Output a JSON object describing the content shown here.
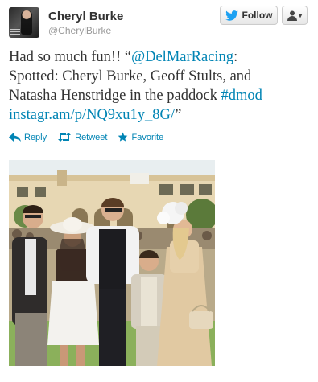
{
  "user": {
    "name": "Cheryl Burke",
    "handle": "@CherylBurke"
  },
  "buttons": {
    "follow_label": "Follow",
    "user_actions_caret": "▾"
  },
  "tweet": {
    "lines": [
      [
        {
          "text": "Had so much fun!! “",
          "link": false
        },
        {
          "text": "@DelMarRacing",
          "link": true
        },
        {
          "text": ":",
          "link": false
        }
      ],
      [
        {
          "text": "Spotted: Cheryl Burke, Geoff Stults, and",
          "link": false
        }
      ],
      [
        {
          "text": "Natasha Henstridge in the paddock ",
          "link": false
        },
        {
          "text": "#dmod",
          "link": true
        }
      ],
      [
        {
          "text": "instagr.am/p/NQ9xu1y_8G/",
          "link": true
        },
        {
          "text": "”",
          "link": false
        }
      ]
    ]
  },
  "actions": {
    "reply": "Reply",
    "retweet": "Retweet",
    "favorite": "Favorite"
  },
  "colors": {
    "link": "#0084b4",
    "twitter_blue": "#1da1f2",
    "favorite_star": "#0084b4"
  },
  "icons": {
    "follow": "twitter-bird-icon",
    "user_actions": "person-icon",
    "reply": "reply-arrow-icon",
    "retweet": "retweet-icon",
    "favorite": "star-icon"
  }
}
